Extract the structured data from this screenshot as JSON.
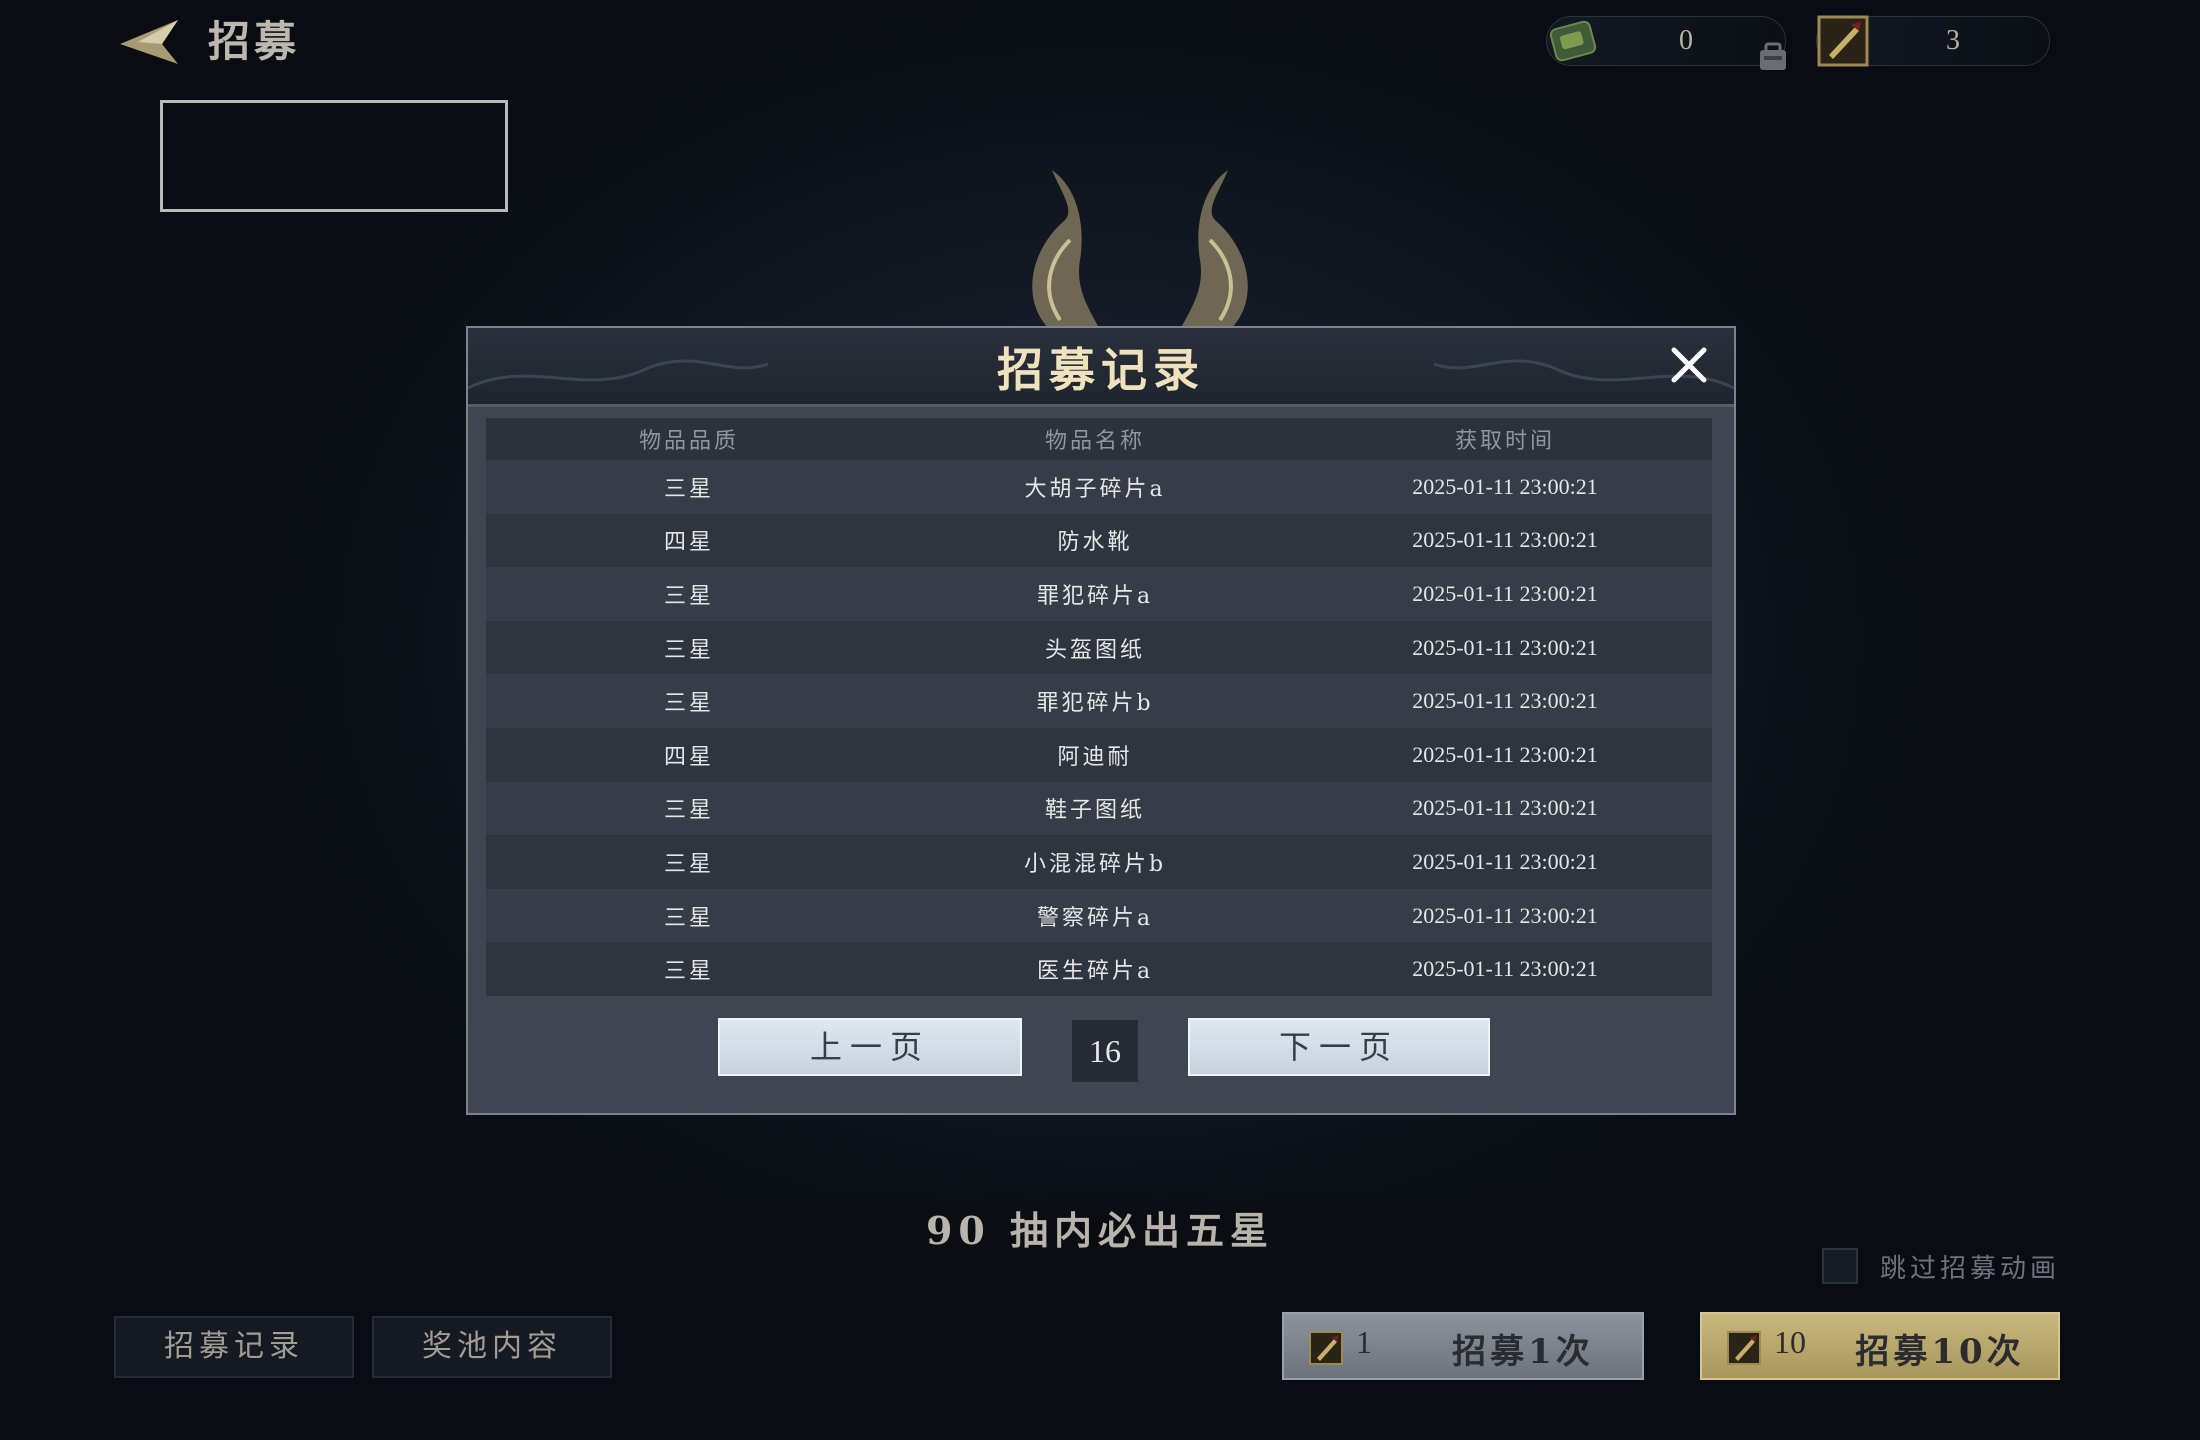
{
  "header": {
    "title": "招募"
  },
  "currencies": [
    {
      "icon": "jade-bundle-icon",
      "value": "0"
    },
    {
      "icon": "recruit-ticket-icon",
      "value": "3"
    }
  ],
  "modal": {
    "title": "招募记录",
    "columns": [
      "物品品质",
      "物品名称",
      "获取时间"
    ],
    "rows": [
      {
        "quality": "三星",
        "name": "大胡子碎片a",
        "time": "2025-01-11 23:00:21"
      },
      {
        "quality": "四星",
        "name": "防水靴",
        "time": "2025-01-11 23:00:21"
      },
      {
        "quality": "三星",
        "name": "罪犯碎片a",
        "time": "2025-01-11 23:00:21"
      },
      {
        "quality": "三星",
        "name": "头盔图纸",
        "time": "2025-01-11 23:00:21"
      },
      {
        "quality": "三星",
        "name": "罪犯碎片b",
        "time": "2025-01-11 23:00:21"
      },
      {
        "quality": "四星",
        "name": "阿迪耐",
        "time": "2025-01-11 23:00:21"
      },
      {
        "quality": "三星",
        "name": "鞋子图纸",
        "time": "2025-01-11 23:00:21"
      },
      {
        "quality": "三星",
        "name": "小混混碎片b",
        "time": "2025-01-11 23:00:21"
      },
      {
        "quality": "三星",
        "name": "警察碎片a",
        "time": "2025-01-11 23:00:21"
      },
      {
        "quality": "三星",
        "name": "医生碎片a",
        "time": "2025-01-11 23:00:21"
      }
    ],
    "prev_label": "上一页",
    "page_number": "16",
    "next_label": "下一页"
  },
  "bottom": {
    "pity_text": "90 抽内必出五星",
    "skip_animation_label": "跳过招募动画",
    "tab_record_label": "招募记录",
    "tab_pool_label": "奖池内容",
    "recruit_one": {
      "cost": "1",
      "label": "招募1次"
    },
    "recruit_ten": {
      "cost": "10",
      "label": "招募10次"
    }
  },
  "colors": {
    "background": "#141b26",
    "modal_bg": "#3f4651",
    "title_gold": "#efe2bd",
    "button_gold": "#c9b77c",
    "button_gray": "#8c939c"
  }
}
